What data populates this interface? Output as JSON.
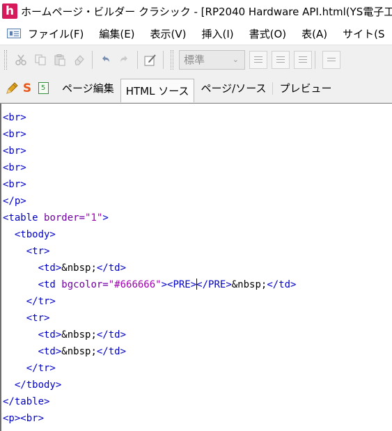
{
  "window": {
    "app_logo_letter": "h",
    "title": "ホームページ・ビルダー クラシック - [RP2040 Hardware API.html(YS電子工"
  },
  "menu": {
    "items": [
      "ファイル(F)",
      "編集(E)",
      "表示(V)",
      "挿入(I)",
      "書式(O)",
      "表(A)",
      "サイト(S"
    ]
  },
  "toolbar": {
    "style_select_value": "標準",
    "icons": [
      "cut-icon",
      "copy-icon",
      "paste-icon",
      "eraser-icon",
      "undo-icon",
      "redo-icon",
      "edit-note-icon"
    ]
  },
  "tabs": {
    "s_label": "S",
    "five_label": "5",
    "items": [
      "ページ編集",
      "HTML ソース",
      "ページ/ソース",
      "プレビュー"
    ],
    "active_index": 1
  },
  "colors": {
    "accent_logo": "#d6195b",
    "tag": "#0000c8",
    "attr": "#7000a0",
    "value": "#a000b0"
  },
  "source": {
    "lines": [
      [
        {
          "t": "tag",
          "v": "<br>"
        }
      ],
      [
        {
          "t": "tag",
          "v": "<br>"
        }
      ],
      [
        {
          "t": "tag",
          "v": "<br>"
        }
      ],
      [
        {
          "t": "tag",
          "v": "<br>"
        }
      ],
      [
        {
          "t": "tag",
          "v": "<br>"
        }
      ],
      [
        {
          "t": "tag",
          "v": "</p>"
        }
      ],
      [
        {
          "t": "tag",
          "v": "<table "
        },
        {
          "t": "attr",
          "v": "border="
        },
        {
          "t": "val",
          "v": "\"1\""
        },
        {
          "t": "tag",
          "v": ">"
        }
      ],
      [
        {
          "t": "tag",
          "v": "  <tbody>"
        }
      ],
      [
        {
          "t": "tag",
          "v": "    <tr>"
        }
      ],
      [
        {
          "t": "tag",
          "v": "      <td>"
        },
        {
          "t": "text",
          "v": "&nbsp;"
        },
        {
          "t": "tag",
          "v": "</td>"
        }
      ],
      [
        {
          "t": "tag",
          "v": "      <td "
        },
        {
          "t": "attr",
          "v": "bgcolor="
        },
        {
          "t": "val",
          "v": "\"#666666\""
        },
        {
          "t": "tag",
          "v": "><PRE>"
        },
        {
          "t": "caret",
          "v": ""
        },
        {
          "t": "tag",
          "v": "</PRE>"
        },
        {
          "t": "text",
          "v": "&nbsp;"
        },
        {
          "t": "tag",
          "v": "</td>"
        }
      ],
      [
        {
          "t": "tag",
          "v": "    </tr>"
        }
      ],
      [
        {
          "t": "tag",
          "v": "    <tr>"
        }
      ],
      [
        {
          "t": "tag",
          "v": "      <td>"
        },
        {
          "t": "text",
          "v": "&nbsp;"
        },
        {
          "t": "tag",
          "v": "</td>"
        }
      ],
      [
        {
          "t": "tag",
          "v": "      <td>"
        },
        {
          "t": "text",
          "v": "&nbsp;"
        },
        {
          "t": "tag",
          "v": "</td>"
        }
      ],
      [
        {
          "t": "tag",
          "v": "    </tr>"
        }
      ],
      [
        {
          "t": "tag",
          "v": "  </tbody>"
        }
      ],
      [
        {
          "t": "tag",
          "v": "</table>"
        }
      ],
      [
        {
          "t": "tag",
          "v": "<p><br>"
        }
      ]
    ]
  }
}
